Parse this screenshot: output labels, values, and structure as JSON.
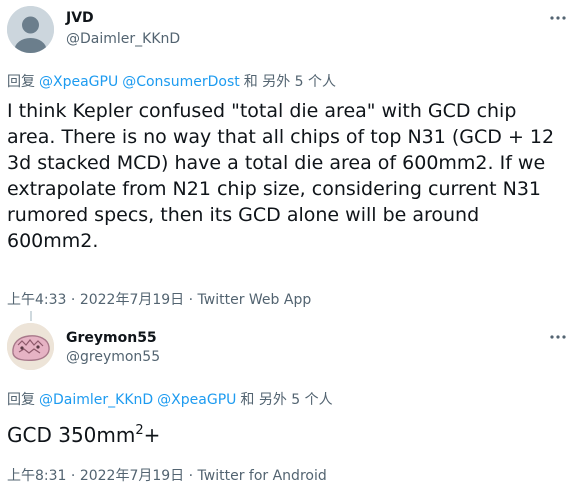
{
  "tweets": [
    {
      "author": {
        "name": "JVD",
        "handle": "@Daimler_KKnD",
        "avatar": "default-avatar"
      },
      "reply": {
        "prefix": "回复",
        "mentions": [
          "@XpeaGPU",
          "@ConsumerDost"
        ],
        "suffix": "和 另外 5 个人"
      },
      "text": "I think Kepler confused \"total die area\" with GCD chip area. There is no way that all chips of top N31 (GCD + 12 3d stacked MCD) have a total die area of 600mm2. If we extrapolate from N21 chip size, considering current N31 rumored specs, then its GCD alone will be around 600mm2.",
      "time": "上午4:33",
      "date": "2022年7月19日",
      "source": "Twitter Web App",
      "separator": "·"
    },
    {
      "author": {
        "name": "Greymon55",
        "handle": "@greymon55",
        "avatar": "pink-creature-avatar"
      },
      "reply": {
        "prefix": "回复",
        "mentions": [
          "@Daimler_KKnD",
          "@XpeaGPU"
        ],
        "suffix": "和 另外 5 个人"
      },
      "text_main": "GCD 350mm",
      "text_sup": "2",
      "text_end": "+",
      "time": "上午8:31",
      "date": "2022年7月19日",
      "source": "Twitter for Android",
      "separator": "·"
    }
  ],
  "colors": {
    "text": "#0f1419",
    "secondary": "#536471",
    "link": "#1d9bf0",
    "thread_line": "#cfd9de"
  },
  "icons": {
    "more": "more-horizontal-icon"
  }
}
